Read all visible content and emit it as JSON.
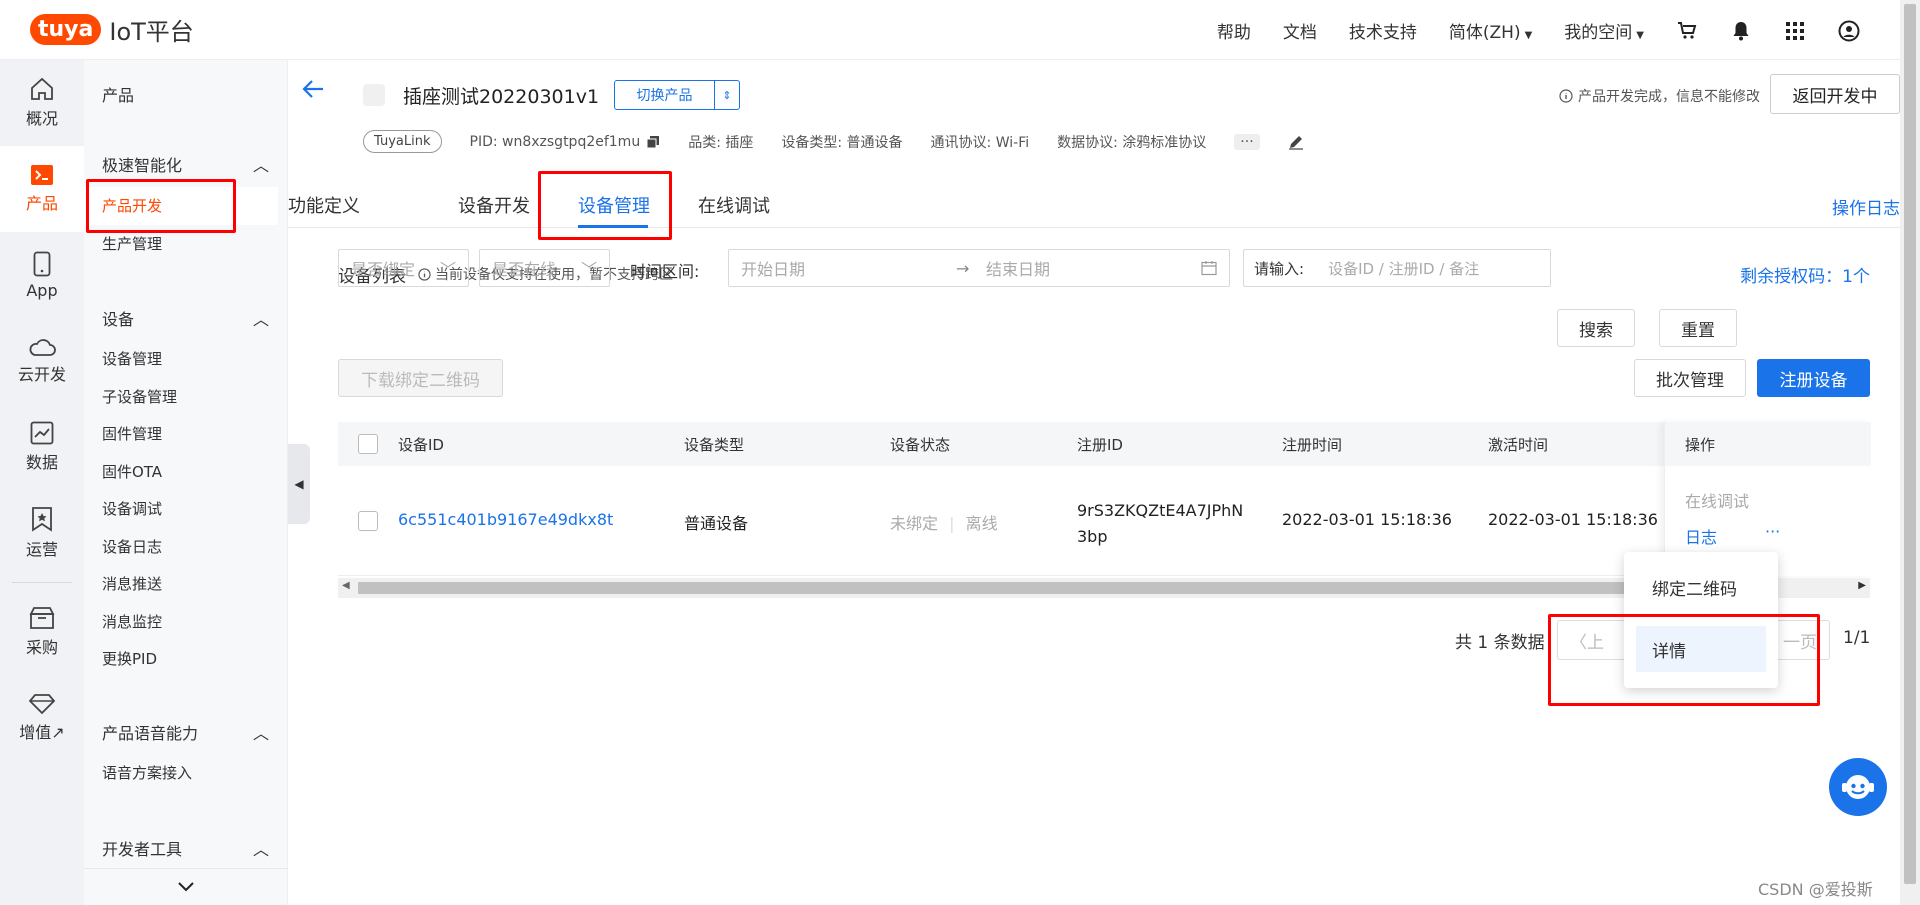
{
  "brand": {
    "logo": "tuya",
    "title": "IoT平台",
    "color": "#ff4800"
  },
  "topnav": {
    "help": "帮助",
    "docs": "文档",
    "support": "技术支持",
    "lang": "简体(ZH)",
    "space": "我的空间"
  },
  "rail": [
    {
      "label": "概况",
      "icon": "home-icon"
    },
    {
      "label": "产品",
      "icon": "terminal-icon",
      "active": true
    },
    {
      "label": "App",
      "icon": "phone-icon"
    },
    {
      "label": "云开发",
      "icon": "cloud-icon"
    },
    {
      "label": "数据",
      "icon": "chart-icon"
    },
    {
      "label": "运营",
      "icon": "bookmark-icon"
    },
    {
      "label": "采购",
      "icon": "store-icon"
    },
    {
      "label": "增值↗",
      "icon": "diamond-icon"
    }
  ],
  "sidebar": {
    "section": "产品",
    "group1": "极速智能化",
    "group1_items": [
      "产品开发",
      "生产管理"
    ],
    "group2": "设备",
    "group2_items": [
      "设备管理",
      "子设备管理",
      "固件管理",
      "固件OTA",
      "设备调试",
      "设备日志",
      "消息推送",
      "消息监控",
      "更换PID"
    ],
    "group3": "产品语音能力",
    "group3_items": [
      "语音方案接入"
    ],
    "group4": "开发者工具"
  },
  "product": {
    "title": "插座测试20220301v1",
    "switch_label": "切换产品",
    "notice": "产品开发完成，信息不能修改",
    "back_button": "返回开发中",
    "link_tag": "TuyaLink",
    "pid": "PID: wn8xzsgtpq2ef1mu",
    "category": "品类: 插座",
    "device_type": "设备类型: 普通设备",
    "protocol": "通讯协议: Wi-Fi",
    "data_protocol": "数据协议: 涂鸦标准协议",
    "more": "···"
  },
  "tabs": [
    "功能定义",
    "设备开发",
    "设备管理",
    "在线调试"
  ],
  "oplog": "操作日志",
  "list": {
    "title": "设备列表",
    "hint": "当前设备仅支持在使用，暂不支持跨区",
    "remain": "剩余授权码：1个"
  },
  "filters": {
    "bind": "是否绑定",
    "online": "是否在线",
    "time_label": "时间区间:",
    "start": "开始日期",
    "end": "结束日期",
    "search_prefix": "请输入:",
    "search_placeholder": "设备ID / 注册ID / 备注",
    "search_btn": "搜索",
    "reset_btn": "重置",
    "download_btn": "下载绑定二维码",
    "batch_btn": "批次管理",
    "register_btn": "注册设备"
  },
  "table": {
    "headers": [
      "设备ID",
      "设备类型",
      "设备状态",
      "注册ID",
      "注册时间",
      "激活时间",
      "操作"
    ],
    "row": {
      "device_id": "6c551c401b9167e49dkx8t",
      "type": "普通设备",
      "bind_status": "未绑定",
      "online_status": "离线",
      "register_id_1": "9rS3ZKQZtE4A7JPhN",
      "register_id_2": "3bp",
      "register_time": "2022-03-01 15:18:36",
      "activate_time": "2022-03-01 15:18:36",
      "op_debug": "在线调试",
      "op_log": "日志",
      "op_more": "···"
    }
  },
  "dropdown": [
    "绑定二维码",
    "详情"
  ],
  "pager": {
    "total": "共 1 条数据",
    "prev": "上",
    "next": "一页",
    "page": "1/1"
  },
  "watermark": "CSDN @爱投斯"
}
